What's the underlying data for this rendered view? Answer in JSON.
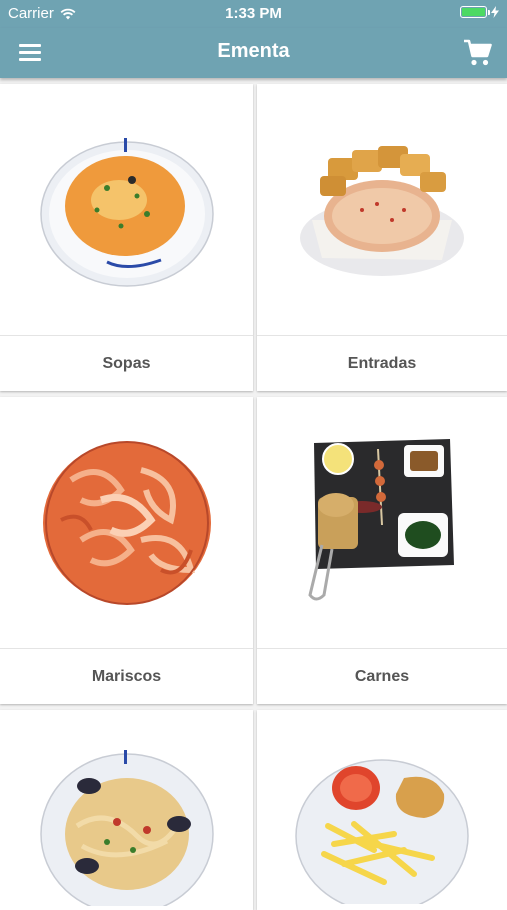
{
  "status_bar": {
    "carrier": "Carrier",
    "time": "1:33 PM",
    "battery_level": 1.0,
    "wifi_icon": "wifi-icon",
    "charging_icon": "bolt-icon"
  },
  "nav": {
    "title": "Ementa",
    "menu_icon": "hamburger-menu-icon",
    "cart_icon": "shopping-cart-icon",
    "background": "#6fa3b2"
  },
  "categories": [
    {
      "label": "Sopas",
      "image": "soup-plate"
    },
    {
      "label": "Entradas",
      "image": "bread-starter"
    },
    {
      "label": "Mariscos",
      "image": "shrimp-platter"
    },
    {
      "label": "Carnes",
      "image": "meat-slate"
    },
    {
      "label": "",
      "image": "pasta-plate"
    },
    {
      "label": "",
      "image": "schnitzel-fries-plate"
    }
  ]
}
